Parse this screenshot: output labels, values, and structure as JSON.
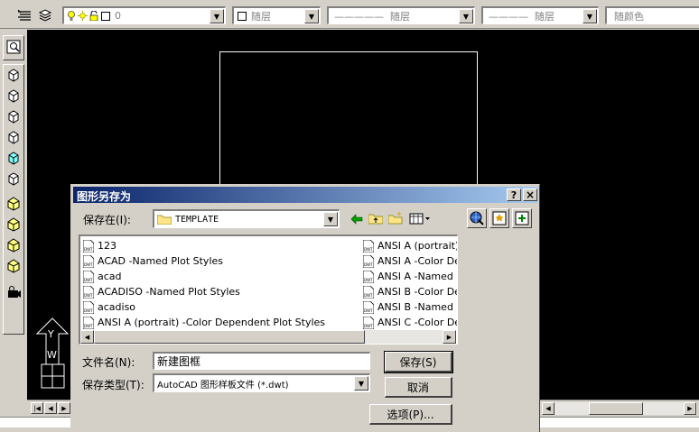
{
  "toolbar": {
    "layer_value": "0",
    "color_value": "随层",
    "linetype_value": "—————  随层",
    "lineweight_value": "————  随层",
    "plotstyle_value": "随颜色"
  },
  "dialog": {
    "title": "图形另存为",
    "save_in_label": "保存在(I):",
    "save_in_value": "TEMPLATE",
    "files_col1": [
      "123",
      "ACAD -Named Plot Styles",
      "acad",
      "ACADISO -Named Plot Styles",
      "acadiso",
      "ANSI A (portrait) -Color Dependent Plot Styles"
    ],
    "files_col2": [
      "ANSI A (portrait) -",
      "ANSI A -Color Dep",
      "ANSI A -Named Plo",
      "ANSI B -Color Dep",
      "ANSI B -Named Plo",
      "ANSI C -Color Dep"
    ],
    "filename_label": "文件名(N):",
    "filename_value": "新建图框",
    "filetype_label": "保存类型(T):",
    "filetype_value": "AutoCAD 图形样板文件 (*.dwt)",
    "save_button": "保存(S)",
    "cancel_button": "取消",
    "options_button": "选项(P)...",
    "help_button": "?",
    "close_button": "×"
  },
  "ucs": {
    "y_label": "Y",
    "w_label": "W"
  },
  "colors": {
    "title_bar_start": "#0a246a",
    "title_bar_end": "#a6caf0",
    "canvas": "#000000"
  }
}
